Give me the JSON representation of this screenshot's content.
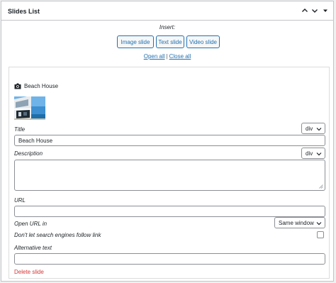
{
  "panel": {
    "title": "Slides List",
    "collapse_up_icon": "chevron-up-icon",
    "collapse_down_icon": "chevron-down-icon",
    "toggle_icon": "triangle-down-icon"
  },
  "insert": {
    "label": "Insert:",
    "buttons": [
      "Image slide",
      "Text slide",
      "Video slide"
    ]
  },
  "links": {
    "open_all": "Open all",
    "separator": "|",
    "close_all": "Close all"
  },
  "slide": {
    "header_icon": "camera-icon",
    "name": "Beach House",
    "title_label": "Title",
    "title_tag": "div",
    "title_value": "Beach House",
    "description_label": "Description",
    "description_tag": "div",
    "description_value": "",
    "url_label": "URL",
    "url_value": "",
    "open_url_label": "Open URL in",
    "open_url_value": "Same window",
    "nofollow_label": "Don't let search engines follow link",
    "nofollow_checked": false,
    "alt_label": "Alternative text",
    "alt_value": "",
    "delete_label": "Delete slide"
  },
  "colors": {
    "accent": "#2271b1",
    "danger": "#d63638",
    "border": "#8c8f94"
  }
}
